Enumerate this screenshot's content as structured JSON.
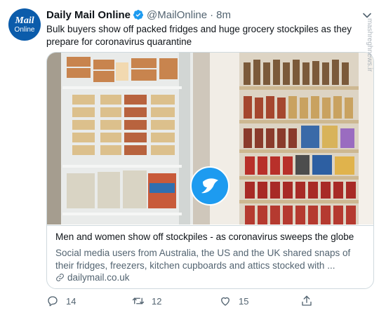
{
  "tweet": {
    "avatar": {
      "line1": "Mail",
      "line2": "Online"
    },
    "display_name": "Daily Mail Online",
    "handle": "@MailOnline",
    "separator": "·",
    "time": "8m",
    "text": "Bulk buyers show off packed fridges and huge grocery stockpiles as they prepare for coronavirus quarantine"
  },
  "card": {
    "title": "Men and women show off stockpiles - as coronavirus sweeps the globe",
    "description": "Social media users from Australia, the US and the UK shared snaps of their fridges, freezers, kitchen cupboards and attics stocked with ...",
    "domain": "dailymail.co.uk"
  },
  "actions": {
    "replies": "14",
    "retweets": "12",
    "likes": "15"
  },
  "watermark": "mashreghnews.ir",
  "colors": {
    "verified": "#1d9bf0",
    "muted": "#536471",
    "border": "#cfd9de",
    "avatar": "#0b5cab"
  }
}
